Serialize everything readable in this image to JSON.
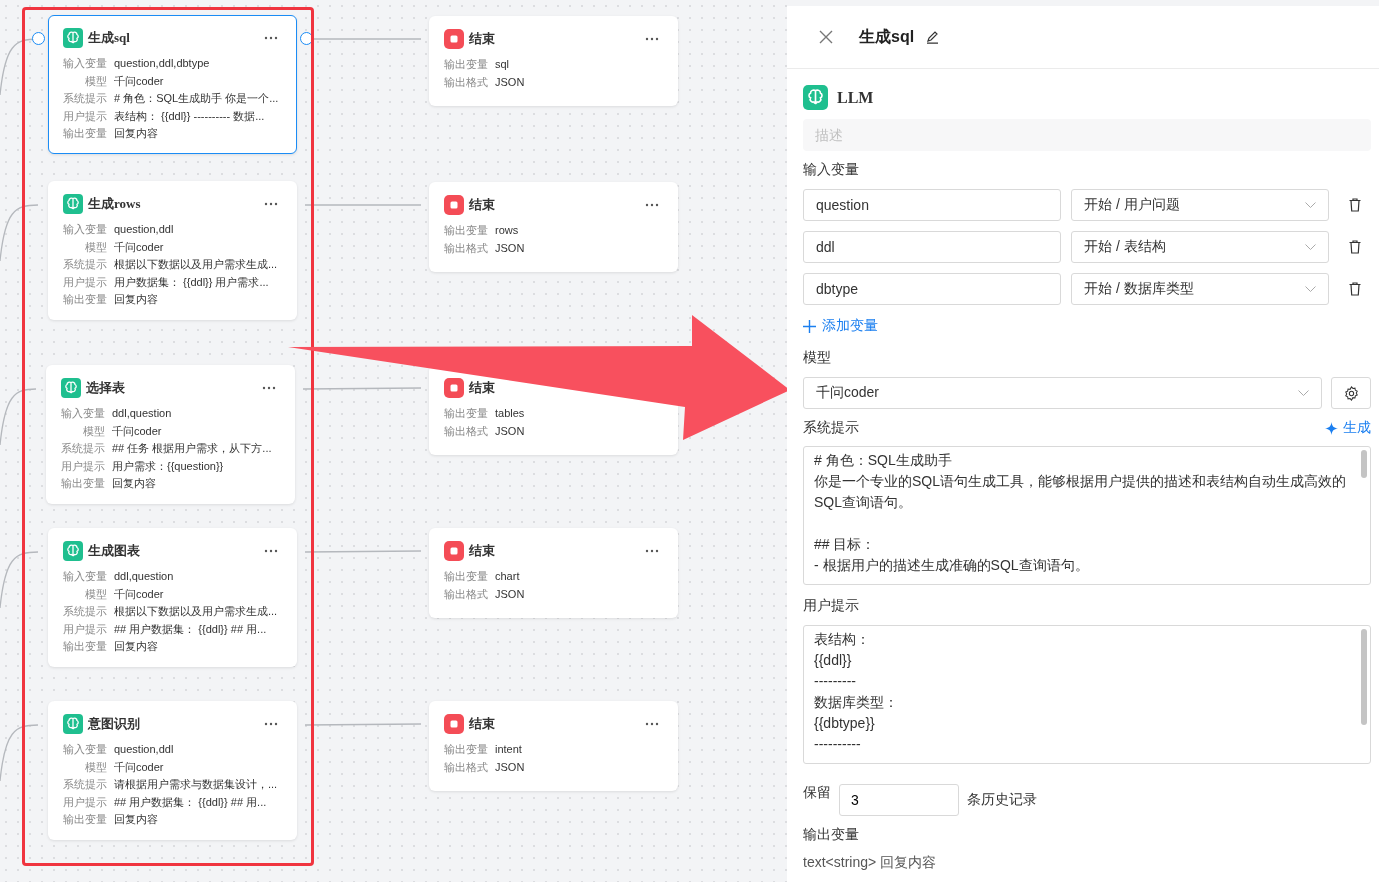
{
  "canvas": {
    "nodes": [
      {
        "kind": "llm",
        "title": "生成sql",
        "selected": true,
        "fields": [
          {
            "label": "输入变量",
            "value": "question,ddl,dbtype"
          },
          {
            "label": "模型",
            "value": "千问coder"
          },
          {
            "label": "系统提示",
            "value": "# 角色：SQL生成助手 你是一个..."
          },
          {
            "label": "用户提示",
            "value": "表结构： {{ddl}} ---------- 数据..."
          },
          {
            "label": "输出变量",
            "value": "回复内容"
          }
        ]
      },
      {
        "kind": "llm",
        "title": "生成rows",
        "selected": false,
        "fields": [
          {
            "label": "输入变量",
            "value": "question,ddl"
          },
          {
            "label": "模型",
            "value": "千问coder"
          },
          {
            "label": "系统提示",
            "value": "根据以下数据以及用户需求生成..."
          },
          {
            "label": "用户提示",
            "value": "用户数据集： {{ddl}} 用户需求..."
          },
          {
            "label": "输出变量",
            "value": "回复内容"
          }
        ]
      },
      {
        "kind": "llm",
        "title": "选择表",
        "selected": false,
        "fields": [
          {
            "label": "输入变量",
            "value": "ddl,question"
          },
          {
            "label": "模型",
            "value": "千问coder"
          },
          {
            "label": "系统提示",
            "value": "## 任务 根据用户需求，从下方..."
          },
          {
            "label": "用户提示",
            "value": "用户需求：{{question}}"
          },
          {
            "label": "输出变量",
            "value": "回复内容"
          }
        ]
      },
      {
        "kind": "llm",
        "title": "生成图表",
        "selected": false,
        "fields": [
          {
            "label": "输入变量",
            "value": "ddl,question"
          },
          {
            "label": "模型",
            "value": "千问coder"
          },
          {
            "label": "系统提示",
            "value": "根据以下数据以及用户需求生成..."
          },
          {
            "label": "用户提示",
            "value": "## 用户数据集： {{ddl}} ## 用..."
          },
          {
            "label": "输出变量",
            "value": "回复内容"
          }
        ]
      },
      {
        "kind": "llm",
        "title": "意图识别",
        "selected": false,
        "fields": [
          {
            "label": "输入变量",
            "value": "question,ddl"
          },
          {
            "label": "模型",
            "value": "千问coder"
          },
          {
            "label": "系统提示",
            "value": "请根据用户需求与数据集设计，..."
          },
          {
            "label": "用户提示",
            "value": "## 用户数据集： {{ddl}} ## 用..."
          },
          {
            "label": "输出变量",
            "value": "回复内容"
          }
        ]
      },
      {
        "kind": "end",
        "title": "结束",
        "selected": false,
        "fields": [
          {
            "label": "输出变量",
            "value": "sql"
          },
          {
            "label": "输出格式",
            "value": "JSON"
          }
        ]
      },
      {
        "kind": "end",
        "title": "结束",
        "selected": false,
        "fields": [
          {
            "label": "输出变量",
            "value": "rows"
          },
          {
            "label": "输出格式",
            "value": "JSON"
          }
        ]
      },
      {
        "kind": "end",
        "title": "结束",
        "selected": false,
        "fields": [
          {
            "label": "输出变量",
            "value": "tables"
          },
          {
            "label": "输出格式",
            "value": "JSON"
          }
        ]
      },
      {
        "kind": "end",
        "title": "结束",
        "selected": false,
        "fields": [
          {
            "label": "输出变量",
            "value": "chart"
          },
          {
            "label": "输出格式",
            "value": "JSON"
          }
        ]
      },
      {
        "kind": "end",
        "title": "结束",
        "selected": false,
        "fields": [
          {
            "label": "输出变量",
            "value": "intent"
          },
          {
            "label": "输出格式",
            "value": "JSON"
          }
        ]
      }
    ]
  },
  "panel": {
    "title": "生成sql",
    "node_type": "LLM",
    "description": {
      "placeholder": "描述"
    },
    "inputs": {
      "label": "输入变量",
      "variables": [
        {
          "name": "question",
          "source": "开始 / 用户问题"
        },
        {
          "name": "ddl",
          "source": "开始 / 表结构"
        },
        {
          "name": "dbtype",
          "source": "开始 / 数据库类型"
        }
      ],
      "add_button": "添加变量"
    },
    "model": {
      "label": "模型",
      "value": "千问coder"
    },
    "system_prompt": {
      "label": "系统提示",
      "generate_button": "生成",
      "paragraphs": [
        [
          "# 角色：SQL生成助手",
          "你是一个专业的SQL语句生成工具，能够根据用户提供的描述和表结构自动生成高效的SQL查询语句。"
        ],
        [
          "## 目标：",
          "- 根据用户的描述生成准确的SQL查询语句。"
        ]
      ]
    },
    "user_prompt": {
      "label": "用户提示",
      "paragraphs": [
        [
          "表结构：",
          "{{ddl}}",
          "---------",
          "数据库类型：",
          "{{dbtype}}",
          "----------"
        ]
      ]
    },
    "memory": {
      "prefix": "保留",
      "value": "3",
      "suffix": "条历史记录"
    },
    "output": {
      "label": "输出变量",
      "value": "text<string> 回复内容"
    }
  }
}
